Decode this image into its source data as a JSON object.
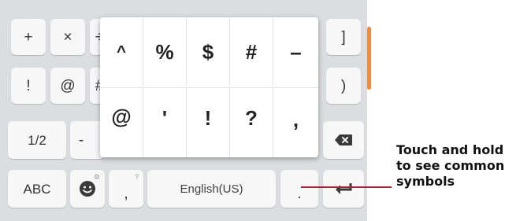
{
  "keyboard": {
    "row1": [
      "+",
      "×",
      "÷",
      "]"
    ],
    "row2": [
      "!",
      "@",
      "#",
      ")"
    ],
    "row3": [
      "1/2",
      "-"
    ],
    "row4": {
      "abc": "ABC",
      "comma": ",",
      "comma_hint": "?",
      "space": "English(US)",
      "period": "."
    },
    "icons": {
      "backspace": "backspace-icon",
      "enter": "enter-icon",
      "emoji": "emoji-icon"
    }
  },
  "popup": {
    "top_row": [
      "^",
      "%",
      "$",
      "#",
      "–"
    ],
    "bottom_row": [
      "@",
      "'",
      "!",
      "?",
      ","
    ]
  },
  "callout": {
    "lines": [
      "Touch and hold",
      "to see common",
      "symbols"
    ]
  },
  "colors": {
    "keyboard_bg": "#dcdde0",
    "key_bg": "#f7f7f8",
    "accent": "#f08a3c",
    "callout_line": "#b5183a"
  }
}
